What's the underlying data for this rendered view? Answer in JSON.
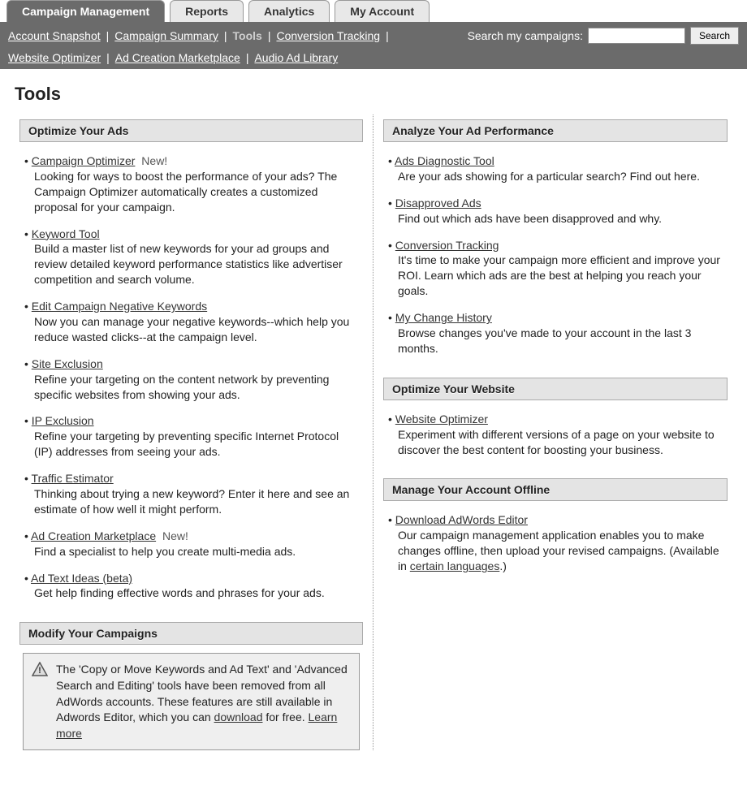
{
  "tabs": [
    {
      "label": "Campaign Management",
      "active": true
    },
    {
      "label": "Reports",
      "active": false
    },
    {
      "label": "Analytics",
      "active": false
    },
    {
      "label": "My Account",
      "active": false
    }
  ],
  "subnav": {
    "row1": [
      {
        "label": "Account Snapshot",
        "current": false
      },
      {
        "label": "Campaign Summary",
        "current": false
      },
      {
        "label": "Tools",
        "current": true
      },
      {
        "label": "Conversion Tracking",
        "current": false
      }
    ],
    "row2": [
      {
        "label": "Website Optimizer",
        "current": false
      },
      {
        "label": "Ad Creation Marketplace",
        "current": false
      },
      {
        "label": "Audio Ad Library",
        "current": false
      }
    ],
    "search_label": "Search my campaigns:",
    "search_button": "Search"
  },
  "page_title": "Tools",
  "left": {
    "section1": {
      "title": "Optimize Your Ads",
      "items": [
        {
          "link": "Campaign Optimizer",
          "tag": "New!",
          "desc": "Looking for ways to boost the performance of your ads? The Campaign Optimizer automatically creates a customized proposal for your campaign."
        },
        {
          "link": "Keyword Tool",
          "desc": "Build a master list of new keywords for your ad groups and review detailed keyword performance statistics like advertiser competition and search volume."
        },
        {
          "link": "Edit Campaign Negative Keywords",
          "desc": "Now you can manage your negative keywords--which help you reduce wasted clicks--at the campaign level."
        },
        {
          "link": "Site Exclusion",
          "desc": "Refine your targeting on the content network by preventing specific websites from showing your ads."
        },
        {
          "link": "IP Exclusion",
          "desc": "Refine your targeting by preventing specific Internet Protocol (IP) addresses from seeing your ads."
        },
        {
          "link": "Traffic Estimator",
          "desc": "Thinking about trying a new keyword? Enter it here and see an estimate of how well it might perform."
        },
        {
          "link": "Ad Creation Marketplace",
          "tag": "New!",
          "desc": "Find a specialist to help you create multi-media ads."
        },
        {
          "link": "Ad Text Ideas (beta)",
          "desc": "Get help finding effective words and phrases for your ads."
        }
      ]
    },
    "section2": {
      "title": "Modify Your Campaigns",
      "notice_pre": "The 'Copy or Move Keywords and Ad Text' and 'Advanced Search and Editing' tools have been removed from all AdWords accounts. These features are still available in Adwords Editor, which you can ",
      "notice_link1": "download",
      "notice_mid": " for free. ",
      "notice_link2": "Learn more"
    }
  },
  "right": {
    "section1": {
      "title": "Analyze Your Ad Performance",
      "items": [
        {
          "link": "Ads Diagnostic Tool",
          "desc": "Are your ads showing for a particular search? Find out here."
        },
        {
          "link": "Disapproved Ads",
          "desc": "Find out which ads have been disapproved and why."
        },
        {
          "link": "Conversion Tracking",
          "desc": "It's time to make your campaign more efficient and improve your ROI. Learn which ads are the best at helping you reach your goals."
        },
        {
          "link": "My Change History",
          "desc": "Browse changes you've made to your account in the last 3 months."
        }
      ]
    },
    "section2": {
      "title": "Optimize Your Website",
      "items": [
        {
          "link": "Website Optimizer",
          "desc": "Experiment with different versions of a page on your website to discover the best content for boosting your business."
        }
      ]
    },
    "section3": {
      "title": "Manage Your Account Offline",
      "items": [
        {
          "link": "Download AdWords Editor",
          "desc_pre": "Our campaign management application enables you to make changes offline, then upload your revised campaigns. (Available in ",
          "desc_link": "certain languages",
          "desc_post": ".)"
        }
      ]
    }
  }
}
